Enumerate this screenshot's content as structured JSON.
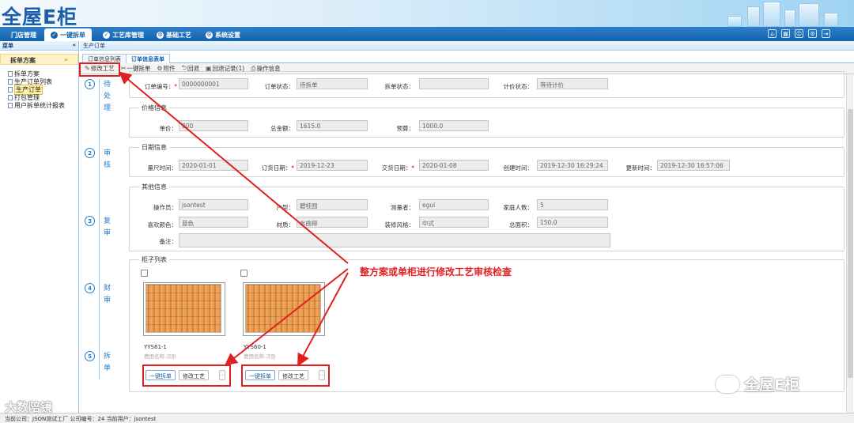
{
  "app": {
    "logo": "全屋E柜"
  },
  "nav": {
    "items": [
      {
        "label": "门店管理",
        "icon": "none"
      },
      {
        "label": "一键拆单",
        "icon": "check-icon",
        "active": true
      },
      {
        "label": "工艺库管理",
        "icon": "check-icon"
      },
      {
        "label": "基础工艺",
        "icon": "gear-icon"
      },
      {
        "label": "系统设置",
        "icon": "gear-icon"
      }
    ]
  },
  "sidebar": {
    "header": "菜单",
    "collapse": "«",
    "section": "拆单方案",
    "section_toggle": "»",
    "items": [
      {
        "label": "拆单方案"
      },
      {
        "label": "生产订单列表"
      },
      {
        "label": "生产订单",
        "selected": true
      },
      {
        "label": "打包管理"
      },
      {
        "label": "用户拆单统计报表"
      }
    ]
  },
  "breadcrumb": "生产订单",
  "tabs": [
    {
      "label": "订单信息列表"
    },
    {
      "label": "订单信息表单",
      "active": true
    }
  ],
  "toolbar": [
    {
      "label": "修改工艺",
      "icon": "pencil-icon",
      "glyph": "✎"
    },
    {
      "label": "一键拆单",
      "icon": "scissors-icon",
      "glyph": "✂"
    },
    {
      "label": "附件",
      "icon": "attachment-icon",
      "glyph": "⚙"
    },
    {
      "label": "回退",
      "icon": "back-icon",
      "glyph": "⮌"
    },
    {
      "label": "回退记录(1)",
      "icon": "record-icon",
      "glyph": "▣"
    },
    {
      "label": "操作信息",
      "icon": "print-icon",
      "glyph": "⎙"
    }
  ],
  "steps": [
    {
      "num": "1",
      "label": "待处理"
    },
    {
      "num": "2",
      "label": "审核"
    },
    {
      "num": "3",
      "label": "复审"
    },
    {
      "num": "4",
      "label": "财审"
    },
    {
      "num": "5",
      "label": "拆单"
    }
  ],
  "order": {
    "order_no_label": "订单编号：",
    "order_no": "0000000001",
    "status_label": "订单状态：",
    "status": "待拆单",
    "split_status_label": "拆单状态：",
    "split_status": "",
    "pricing_status_label": "计价状态：",
    "pricing_status": "等待计价"
  },
  "price": {
    "legend": "价格信息",
    "unit_label": "单价：",
    "unit": "800",
    "total_label": "总金额：",
    "total": "1615.0",
    "budget_label": "预算：",
    "budget": "1000.0"
  },
  "dates": {
    "legend": "日期信息",
    "measure_label": "量尺时间：",
    "measure": "2020-01-01",
    "order_label": "订货日期：",
    "order": "2019-12-23",
    "delivery_label": "交货日期：",
    "delivery": "2020-01-08",
    "created_label": "创建时间：",
    "created": "2019-12-30 16:29:24",
    "updated_label": "更新时间：",
    "updated": "2019-12-30 16:57:06"
  },
  "other": {
    "legend": "其他信息",
    "operator_label": "操作员：",
    "operator": "jsontest",
    "house_label": "户型：",
    "house": "碧桂园",
    "measurer_label": "测量者：",
    "measurer": "egui",
    "family_label": "家庭人数：",
    "family": "5",
    "color_label": "喜欢颜色：",
    "color": "蓝色",
    "material_label": "材质：",
    "material": "水曲柳",
    "style_label": "装修风格：",
    "style": "中式",
    "area_label": "总面积：",
    "area": "150.0",
    "remark_label": "备注：",
    "remark": ""
  },
  "cabinets": {
    "legend": "柜子列表",
    "items": [
      {
        "name": "YYS61-1",
        "sub": "费用名称:次卧",
        "split_btn": "一键拆单",
        "modify_btn": "修改工艺",
        "more": "..."
      },
      {
        "name": "YYS60-1",
        "sub": "费用名称:次卧",
        "split_btn": "一键拆单",
        "modify_btn": "修改工艺",
        "more": "..."
      }
    ]
  },
  "annotation": "整方案或单柜进行修改工艺审核检查",
  "status": "当前公司：JSON测试工厂   公司编号：24   当前用户：jsontest",
  "watermarks": {
    "left": "大数陪镜",
    "right": "全屋E柜"
  },
  "colors": {
    "accent": "#1663ad",
    "annotation": "#e02020"
  }
}
